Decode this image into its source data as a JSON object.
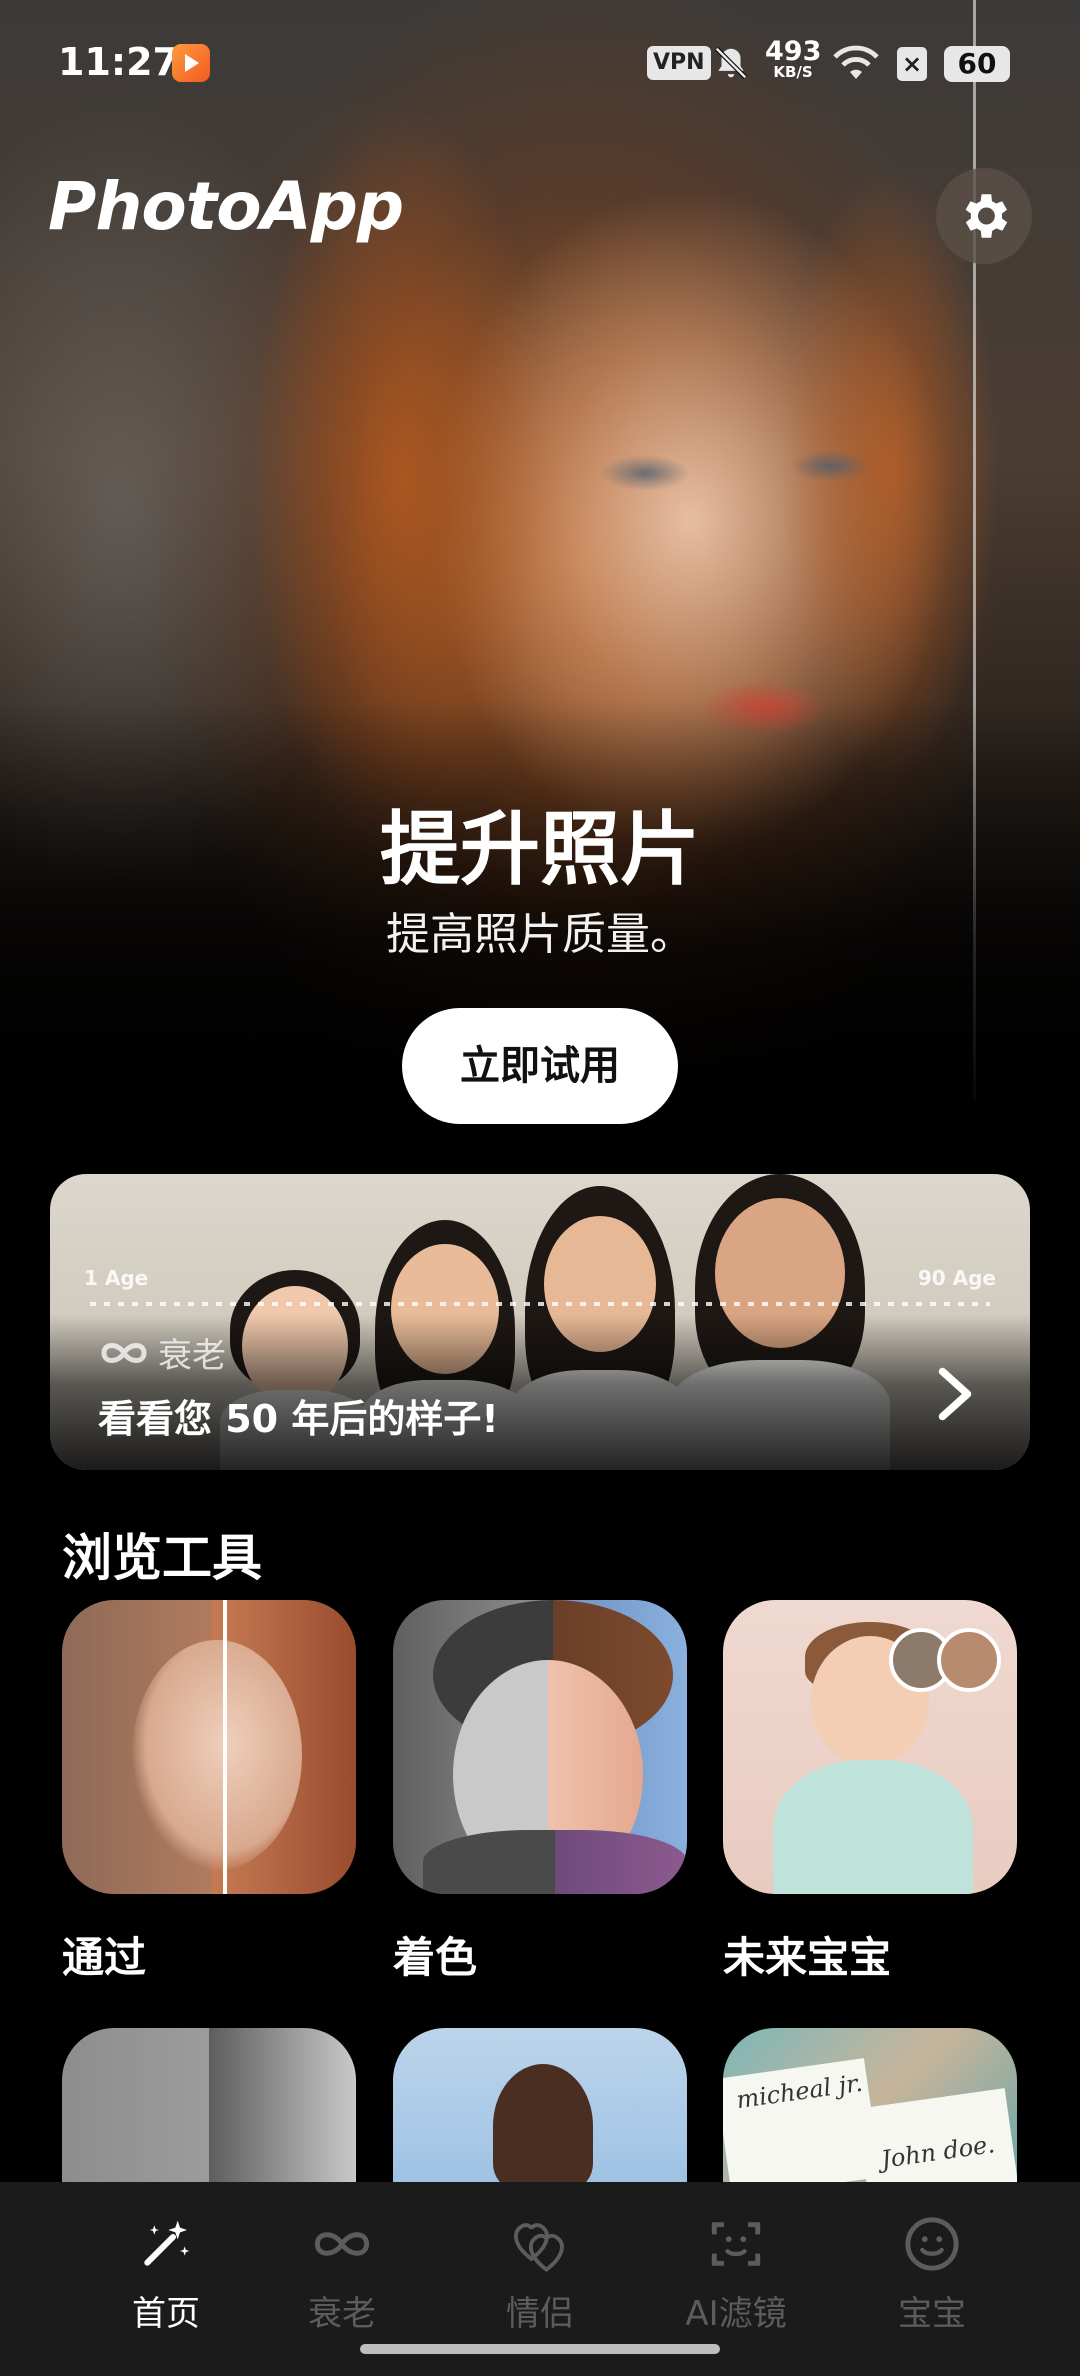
{
  "status_bar": {
    "time": "11:27",
    "vpn": "VPN",
    "net_speed": "493",
    "net_unit": "KB/S",
    "battery": "60"
  },
  "header": {
    "logo": "PhotoApp"
  },
  "hero": {
    "title": "提升照片",
    "subtitle": "提高照片质量。",
    "cta": "立即试用"
  },
  "aging_banner": {
    "age_start": "1 Age",
    "age_end": "90 Age",
    "tag": "衰老",
    "tagline": "看看您 50 年后的样子!"
  },
  "tools_section": {
    "title": "浏览工具",
    "tools": [
      {
        "label": "通过"
      },
      {
        "label": "着色"
      },
      {
        "label": "未来宝宝"
      }
    ],
    "card_names": [
      "micheal jr.",
      "John doe."
    ]
  },
  "tabbar": {
    "tabs": [
      {
        "label": "首页",
        "icon": "magic-wand-icon",
        "active": true
      },
      {
        "label": "衰老",
        "icon": "infinity-icon",
        "active": false
      },
      {
        "label": "情侣",
        "icon": "hearts-icon",
        "active": false
      },
      {
        "label": "AI滤镜",
        "icon": "face-scan-icon",
        "active": false
      },
      {
        "label": "宝宝",
        "icon": "smiley-icon",
        "active": false
      }
    ]
  },
  "colors": {
    "background": "#000000",
    "tabbar_bg": "#1b1b1b",
    "tab_inactive": "#5c5c5c",
    "accent_white": "#ffffff"
  }
}
